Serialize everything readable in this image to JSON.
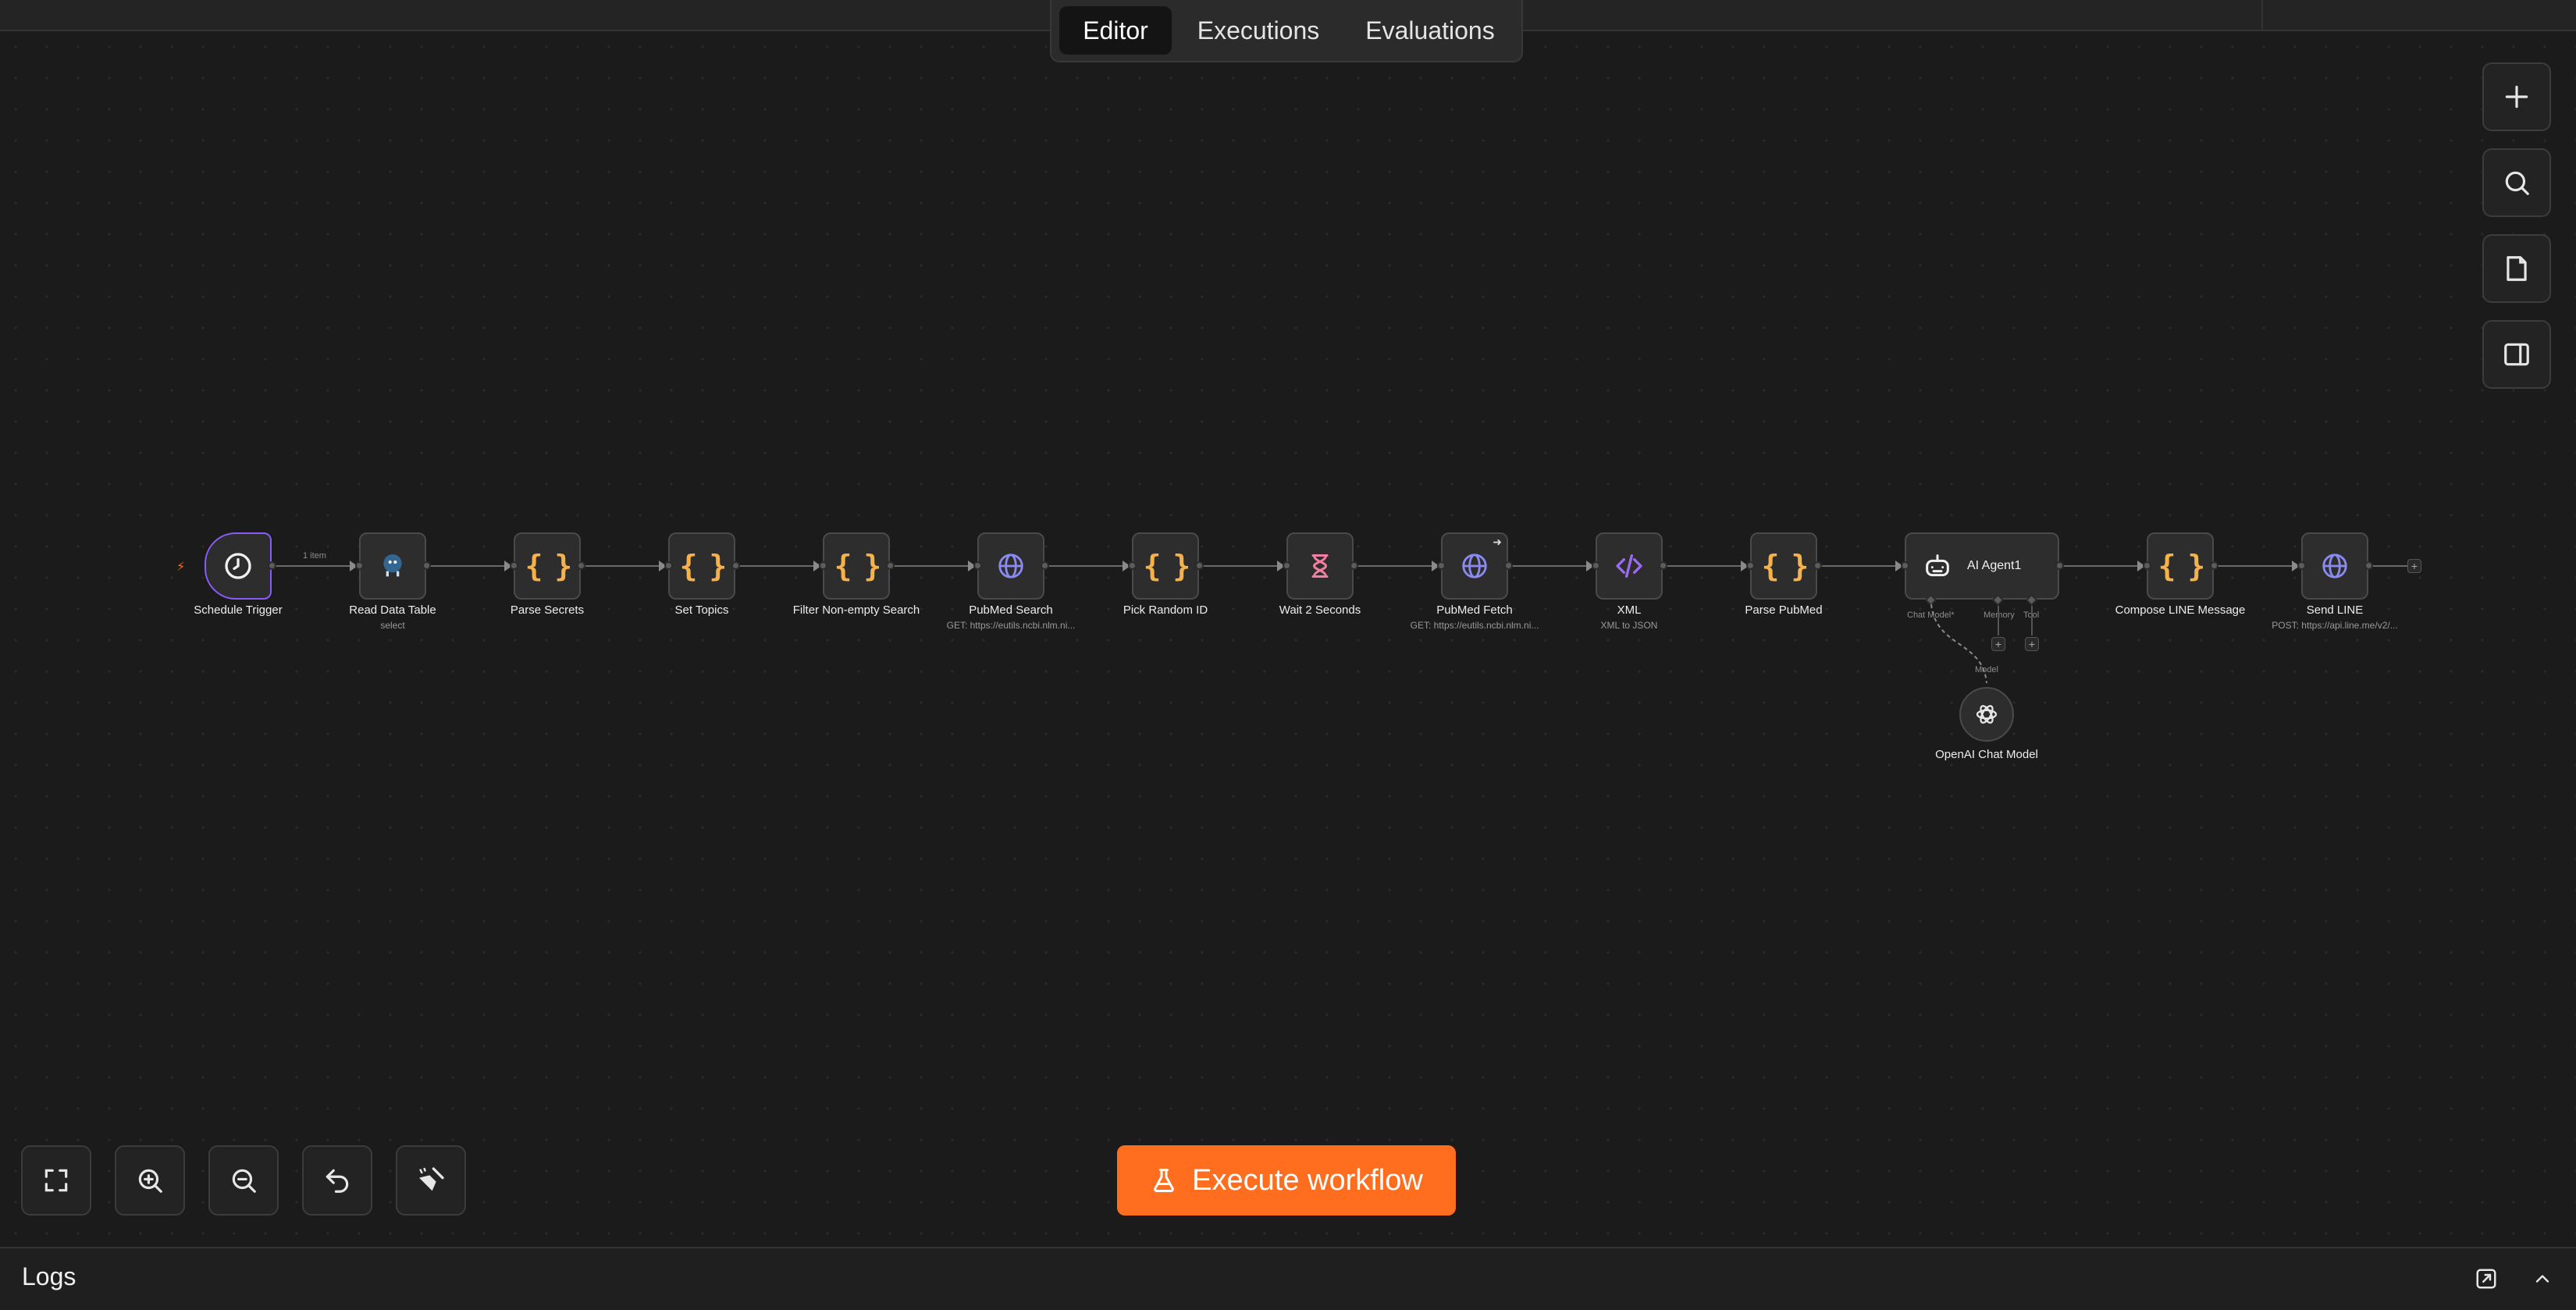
{
  "tabs": [
    {
      "label": "Editor",
      "active": true
    },
    {
      "label": "Executions",
      "active": false
    },
    {
      "label": "Evaluations",
      "active": false
    }
  ],
  "right_toolbar": [
    {
      "name": "add-node-button",
      "icon": "plus-icon"
    },
    {
      "name": "search-nodes-button",
      "icon": "search-icon"
    },
    {
      "name": "sticky-note-button",
      "icon": "note-icon"
    },
    {
      "name": "toggle-panel-button",
      "icon": "sidebar-icon"
    }
  ],
  "bottom_toolbar": [
    {
      "name": "zoom-to-fit-button",
      "icon": "fit-view-icon"
    },
    {
      "name": "zoom-in-button",
      "icon": "zoom-in-icon"
    },
    {
      "name": "zoom-out-button",
      "icon": "zoom-out-icon"
    },
    {
      "name": "undo-button",
      "icon": "undo-icon"
    },
    {
      "name": "tidy-up-button",
      "icon": "broom-icon"
    }
  ],
  "execute_button": {
    "label": "Execute workflow",
    "icon": "flask-icon"
  },
  "logs": {
    "title": "Logs"
  },
  "connection_label": "1 item",
  "nodes": [
    {
      "id": "schedule-trigger",
      "label": "Schedule Trigger",
      "subtitle": "",
      "icon": "clock-icon"
    },
    {
      "id": "read-data-table",
      "label": "Read Data Table",
      "subtitle": "select",
      "icon": "postgres-icon"
    },
    {
      "id": "parse-secrets",
      "label": "Parse Secrets",
      "subtitle": "",
      "icon": "code-braces-icon"
    },
    {
      "id": "set-topics",
      "label": "Set Topics",
      "subtitle": "",
      "icon": "code-braces-icon"
    },
    {
      "id": "filter-non-empty-search",
      "label": "Filter Non-empty Search",
      "subtitle": "",
      "icon": "code-braces-icon"
    },
    {
      "id": "pubmed-search",
      "label": "PubMed Search",
      "subtitle": "GET: https://eutils.ncbi.nlm.ni...",
      "icon": "globe-icon"
    },
    {
      "id": "pick-random-id",
      "label": "Pick Random ID",
      "subtitle": "",
      "icon": "code-braces-icon"
    },
    {
      "id": "wait-2-seconds",
      "label": "Wait 2 Seconds",
      "subtitle": "",
      "icon": "hourglass-icon"
    },
    {
      "id": "pubmed-fetch",
      "label": "PubMed Fetch",
      "subtitle": "GET: https://eutils.ncbi.nlm.ni...",
      "icon": "globe-icon"
    },
    {
      "id": "xml",
      "label": "XML",
      "subtitle": "XML to JSON",
      "icon": "code-tag-icon"
    },
    {
      "id": "parse-pubmed",
      "label": "Parse PubMed",
      "subtitle": "",
      "icon": "code-braces-icon"
    },
    {
      "id": "ai-agent",
      "label": "AI Agent1",
      "subtitle": "",
      "icon": "robot-icon"
    },
    {
      "id": "compose-line-message",
      "label": "Compose LINE Message",
      "subtitle": "",
      "icon": "code-braces-icon"
    },
    {
      "id": "send-line",
      "label": "Send LINE",
      "subtitle": "POST: https://api.line.me/v2/...",
      "icon": "globe-icon"
    }
  ],
  "agent_ports": {
    "chat_model": "Chat Model*",
    "memory": "Memory",
    "tool": "Tool",
    "model": "Model"
  },
  "sub_node": {
    "label": "OpenAI Chat Model",
    "icon": "openai-icon"
  },
  "colors": {
    "accent": "#ff6d1f",
    "trigger_border": "#8a5cf6",
    "code": "#f5b14a",
    "http": "#8a8af0",
    "wait": "#f27ea3",
    "xml": "#9b6cf0"
  }
}
